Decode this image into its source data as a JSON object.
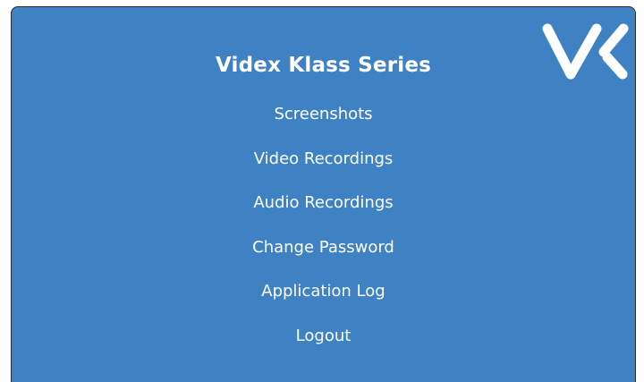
{
  "app": {
    "title": "Videx Klass Series",
    "logo_icon": "vx-logo-icon",
    "background_color": "#3f82c4",
    "text_color": "#ffffff"
  },
  "menu": {
    "items": [
      {
        "label": "Screenshots"
      },
      {
        "label": "Video Recordings"
      },
      {
        "label": "Audio Recordings"
      },
      {
        "label": "Change Password"
      },
      {
        "label": "Application Log"
      },
      {
        "label": "Logout"
      }
    ]
  }
}
